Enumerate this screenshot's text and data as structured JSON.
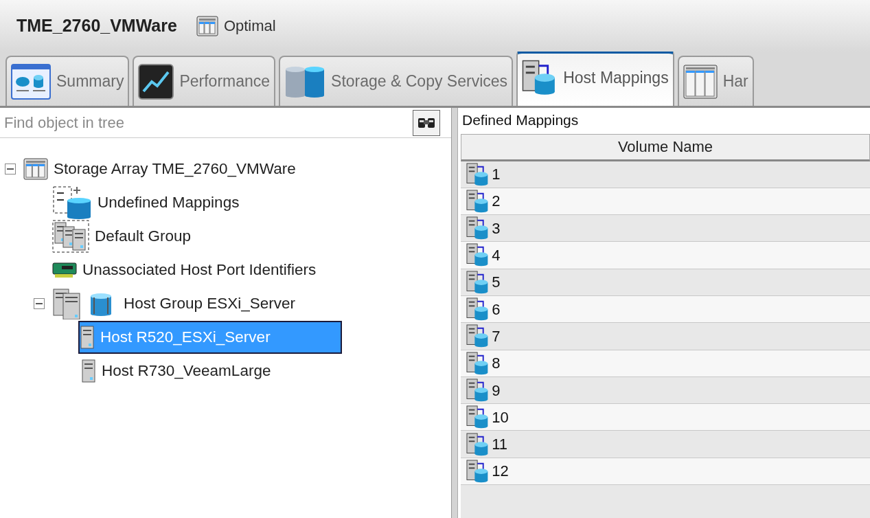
{
  "header": {
    "title": "TME_2760_VMWare",
    "status": "Optimal"
  },
  "tabs": [
    {
      "label": "Summary",
      "kind": "summary",
      "selected": false
    },
    {
      "label": "Performance",
      "kind": "performance",
      "selected": false
    },
    {
      "label": "Storage & Copy Services",
      "kind": "storage",
      "selected": false
    },
    {
      "label": "Host Mappings",
      "kind": "mapping",
      "selected": true
    },
    {
      "label": "Har",
      "kind": "hardware",
      "selected": false
    }
  ],
  "search": {
    "placeholder": "Find object in tree"
  },
  "tree": [
    {
      "label": "Storage Array TME_2760_VMWare",
      "kind": "array",
      "selected": false,
      "expanded": true,
      "children": [
        {
          "label": "Undefined Mappings",
          "kind": "undefined",
          "selected": false
        },
        {
          "label": "Default Group",
          "kind": "default-group",
          "selected": false
        },
        {
          "label": "Unassociated Host Port Identifiers",
          "kind": "port",
          "selected": false
        },
        {
          "label": "Host Group ESXi_Server",
          "kind": "host-group",
          "selected": false,
          "expanded": true,
          "children": [
            {
              "label": "Host R520_ESXi_Server",
              "kind": "host",
              "selected": true
            },
            {
              "label": "Host R730_VeeamLarge",
              "kind": "host",
              "selected": false
            }
          ]
        }
      ]
    }
  ],
  "mappings": {
    "title": "Defined Mappings",
    "columns": [
      "Volume Name"
    ],
    "rows": [
      "1",
      "2",
      "3",
      "4",
      "5",
      "6",
      "7",
      "8",
      "9",
      "10",
      "11",
      "12"
    ]
  }
}
